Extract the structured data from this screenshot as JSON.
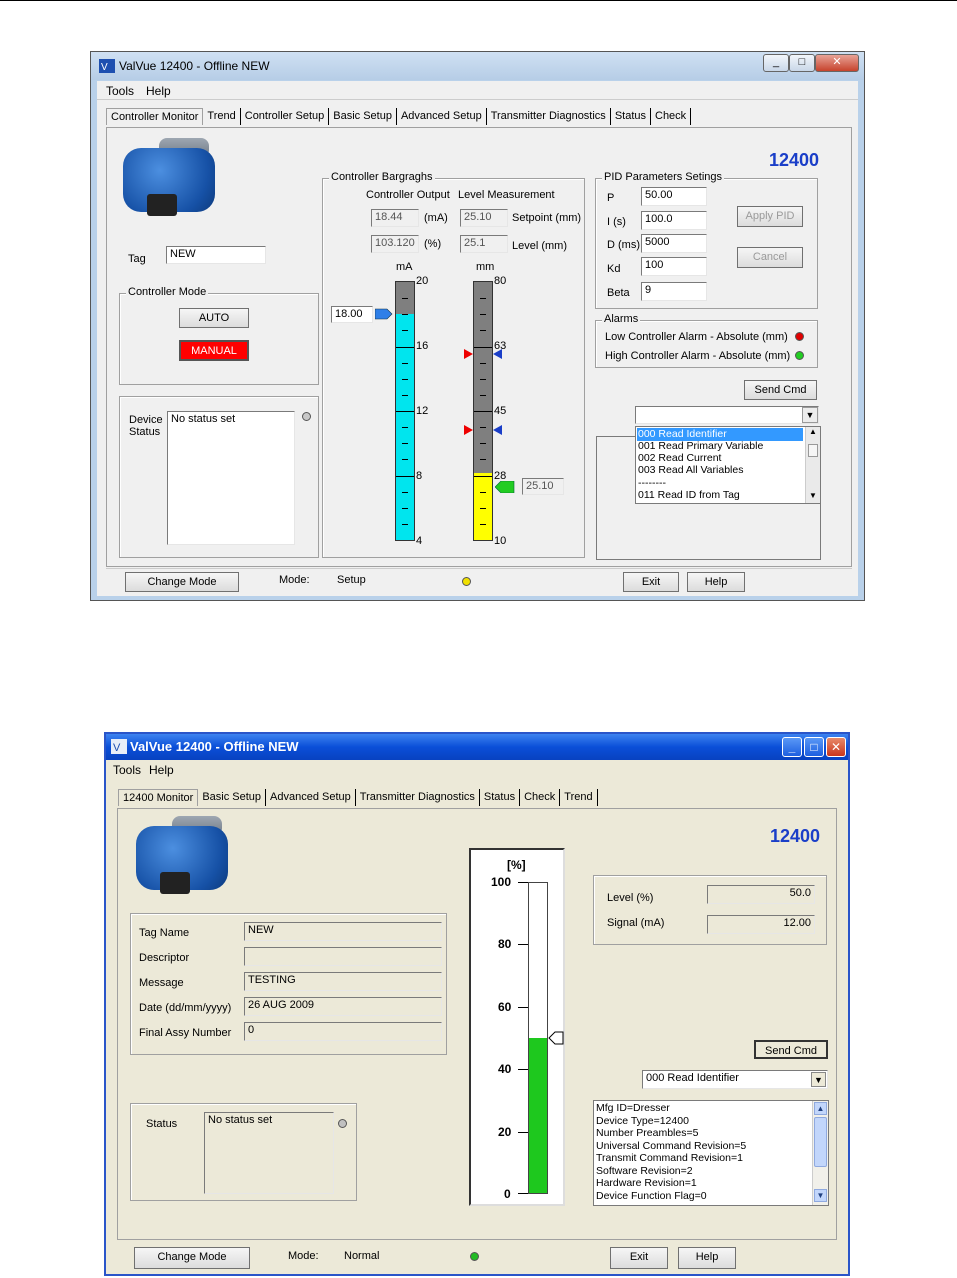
{
  "window1": {
    "title": "ValVue 12400 - Offline  NEW",
    "menu": [
      "Tools",
      "Help"
    ],
    "tabs": [
      "Controller Monitor",
      "Trend",
      "Controller Setup",
      "Basic Setup",
      "Advanced Setup",
      "Transmitter Diagnostics",
      "Status",
      "Check"
    ],
    "model": "12400",
    "tag_label": "Tag",
    "tag_value": "NEW",
    "controller_mode": {
      "title": "Controller Mode",
      "auto_label": "AUTO",
      "manual_label": "MANUAL"
    },
    "device_status": {
      "label": "Device Status",
      "text": "No status set"
    },
    "bargraphs": {
      "title": "Controller Bargraghs",
      "output_header": "Controller Output",
      "level_header": "Level Measurement",
      "output_ma": "18.44",
      "unit_ma": "(mA)",
      "output_pct": "103.120",
      "unit_pct": "(%)",
      "setpoint": "25.10",
      "setpoint_label": "Setpoint (mm)",
      "level": "25.1",
      "level_label": "Level  (mm)",
      "ma_unit": "mA",
      "mm_unit": "mm",
      "ma_ticks": [
        "20",
        "16",
        "12",
        "8",
        "4"
      ],
      "mm_ticks": [
        "80",
        "63",
        "45",
        "28",
        "10"
      ],
      "ma_input": "18.00",
      "level_readout": "25.10",
      "ma_fill_fraction": 0.875,
      "level_fill_fraction": 0.26
    },
    "pid": {
      "title": "PID Parameters Setings",
      "p_label": "P",
      "p_value": "50.00",
      "i_label": "I  (s)",
      "i_value": "100.0",
      "d_label": "D (ms)",
      "d_value": "5000",
      "kd_label": "Kd",
      "kd_value": "100",
      "beta_label": "Beta",
      "beta_value": "9",
      "apply_label": "Apply PID",
      "cancel_label": "Cancel"
    },
    "alarms": {
      "title": "Alarms",
      "low": "Low Controller Alarm -  Absolute   (mm)",
      "high": "High Controller Alarm -  Absolute   (mm)",
      "low_color": "#e00000",
      "high_color": "#22cc22"
    },
    "send_cmd_label": "Send Cmd",
    "commands": [
      "000 Read Identifier",
      "001 Read Primary Variable",
      "002 Read Current",
      "003 Read All Variables",
      "--------",
      "011 Read ID from Tag"
    ],
    "bottom": {
      "change_mode": "Change Mode",
      "mode_label": "Mode:",
      "mode_value": "Setup",
      "exit": "Exit",
      "help": "Help",
      "indicator_color": "#f0e000"
    }
  },
  "window2": {
    "title": "ValVue 12400 - Offline  NEW",
    "menu": [
      "Tools",
      "Help"
    ],
    "tabs": [
      "12400 Monitor",
      "Basic Setup",
      "Advanced Setup",
      "Transmitter Diagnostics",
      "Status",
      "Check",
      "Trend"
    ],
    "model": "12400",
    "fields": [
      {
        "label": "Tag Name",
        "value": "NEW"
      },
      {
        "label": "Descriptor",
        "value": ""
      },
      {
        "label": "Message",
        "value": "TESTING"
      },
      {
        "label": "Date (dd/mm/yyyy)",
        "value": "26 AUG 2009"
      },
      {
        "label": "Final Assy Number",
        "value": "0"
      }
    ],
    "status_label": "Status",
    "status_text": "No status set",
    "bar": {
      "unit": "[%]",
      "ticks": [
        "100",
        "80",
        "60",
        "40",
        "20",
        "0"
      ],
      "fill_percent": 50
    },
    "level_label": "Level  (%)",
    "level_value": "50.0",
    "signal_label": "Signal (mA)",
    "signal_value": "12.00",
    "send_cmd_label": "Send Cmd",
    "command_selected": "000 Read Identifier",
    "info_lines": [
      "Mfg ID=Dresser",
      "Device Type=12400",
      "Number Preambles=5",
      "Universal Command Revision=5",
      "Transmit Command Revision=1",
      "Software Revision=2",
      "Hardware Revision=1",
      "Device Function Flag=0"
    ],
    "bottom": {
      "change_mode": "Change Mode",
      "mode_label": "Mode:",
      "mode_value": "Normal",
      "exit": "Exit",
      "help": "Help",
      "indicator_color": "#22bb22"
    }
  }
}
